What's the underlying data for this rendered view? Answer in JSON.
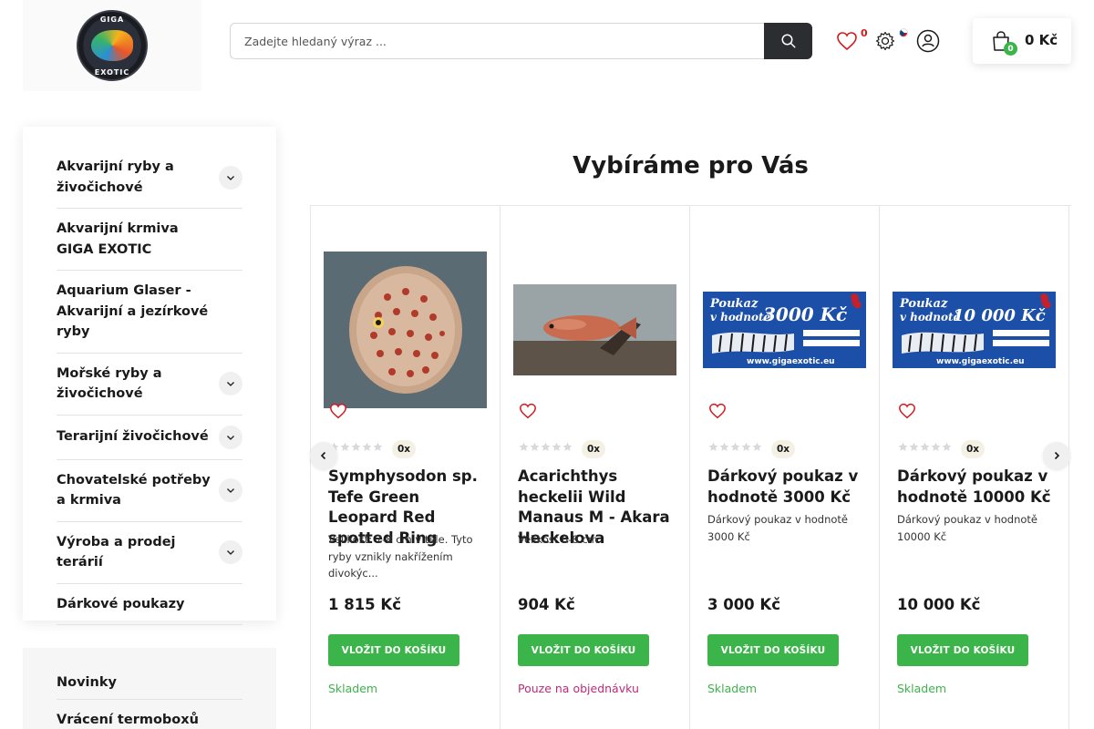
{
  "header": {
    "logo": {
      "top_text": "GIGA",
      "bottom_text": "EXOTIC"
    },
    "search": {
      "placeholder": "Zadejte hledaný výraz ..."
    },
    "wishlist_count": "0",
    "cart": {
      "count": "0",
      "total": "0 Kč"
    }
  },
  "sidebar": {
    "categories": [
      {
        "label": "Akvarijní ryby a živočichové",
        "has_submenu": true
      },
      {
        "label": "Akvarijní krmiva GIGA EXOTIC",
        "has_submenu": false
      },
      {
        "label": "Aquarium Glaser - Akvarijní a jezírkové ryby",
        "has_submenu": false
      },
      {
        "label": "Mořské ryby a živočichové",
        "has_submenu": true
      },
      {
        "label": "Terarijní živočichové",
        "has_submenu": true
      },
      {
        "label": "Chovatelské potřeby a krmiva",
        "has_submenu": true
      },
      {
        "label": "Výroba a prodej terárií",
        "has_submenu": true
      },
      {
        "label": "Dárkové poukazy",
        "has_submenu": false
      }
    ],
    "links": [
      {
        "label": "Novinky"
      },
      {
        "label": "Vrácení termoboxů"
      }
    ]
  },
  "recommended": {
    "title": "Vybíráme pro Vás",
    "buy_label": "VLOŽIT DO KOŠÍKU",
    "products": [
      {
        "name": "Symphysodon sp. Tefe Green Leopard Red spotted Ring",
        "description": "Velikost: 7-8 cm v těle. Tyto ryby vznikly nakřížením divokýc...",
        "price": "1 815 Kč",
        "rating_count": "0x",
        "stock": "Skladem",
        "stock_color": "#3bb44a",
        "image": "discus-fish"
      },
      {
        "name": "Acarichthys heckelii Wild Manaus M - Akara Heckelova",
        "description": "Velikost 6-8 cm",
        "price": "904 Kč",
        "rating_count": "0x",
        "stock": "Pouze na objednávku",
        "stock_color": "#c0287a",
        "image": "cichlid-fish"
      },
      {
        "name": "Dárkový poukaz v hodnotě 3000 Kč",
        "description": "Dárkový poukaz v hodnotě 3000 Kč",
        "price": "3 000 Kč",
        "rating_count": "0x",
        "stock": "Skladem",
        "stock_color": "#3bb44a",
        "image": "gift-voucher",
        "voucher": {
          "line1": "Poukaz",
          "line2": "v hodnotě",
          "amount": "3000 Kč",
          "site": "www.gigaexotic.eu"
        }
      },
      {
        "name": "Dárkový poukaz v hodnotě 10000 Kč",
        "description": "Dárkový poukaz v hodnotě 10000 Kč",
        "price": "10 000 Kč",
        "rating_count": "0x",
        "stock": "Skladem",
        "stock_color": "#3bb44a",
        "image": "gift-voucher",
        "voucher": {
          "line1": "Poukaz",
          "line2": "v hodnotě",
          "amount": "10 000 Kč",
          "site": "www.gigaexotic.eu"
        }
      }
    ]
  }
}
